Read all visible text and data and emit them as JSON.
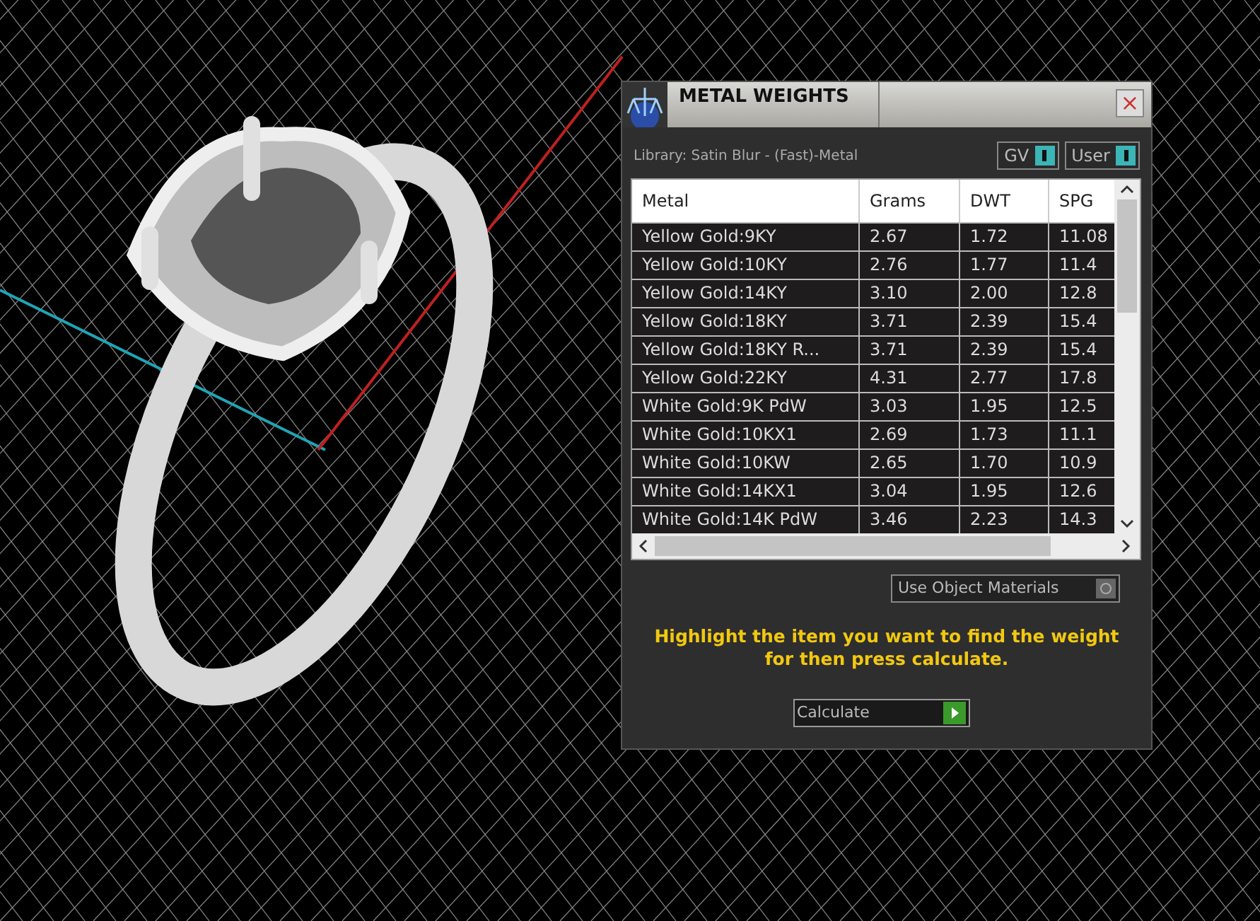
{
  "window": {
    "title": "METAL WEIGHTS",
    "close": "×"
  },
  "library": "Library: Satin Blur - (Fast)-Metal",
  "toggles": [
    {
      "label": "GV",
      "on": true
    },
    {
      "label": "User",
      "on": true
    }
  ],
  "table": {
    "columns": [
      "Metal",
      "Grams",
      "DWT",
      "SPG"
    ],
    "rows": [
      [
        "Yellow Gold:9KY",
        "2.67",
        "1.72",
        "11.08"
      ],
      [
        "Yellow Gold:10KY",
        "2.76",
        "1.77",
        "11.4"
      ],
      [
        "Yellow Gold:14KY",
        "3.10",
        "2.00",
        "12.8"
      ],
      [
        "Yellow Gold:18KY",
        "3.71",
        "2.39",
        "15.4"
      ],
      [
        "Yellow Gold:18KY R...",
        "3.71",
        "2.39",
        "15.4"
      ],
      [
        "Yellow Gold:22KY",
        "4.31",
        "2.77",
        "17.8"
      ],
      [
        "White Gold:9K PdW",
        "3.03",
        "1.95",
        "12.5"
      ],
      [
        "White Gold:10KX1",
        "2.69",
        "1.73",
        "11.1"
      ],
      [
        "White Gold:10KW",
        "2.65",
        "1.70",
        "10.9"
      ],
      [
        "White Gold:14KX1",
        "3.04",
        "1.95",
        "12.6"
      ],
      [
        "White Gold:14K PdW",
        "3.46",
        "2.23",
        "14.3"
      ]
    ]
  },
  "use_object_materials": {
    "label": "Use Object Materials",
    "on": false
  },
  "hint": "Highlight the item you want to find the weight for then press calculate.",
  "calculate_button": "Calculate"
}
